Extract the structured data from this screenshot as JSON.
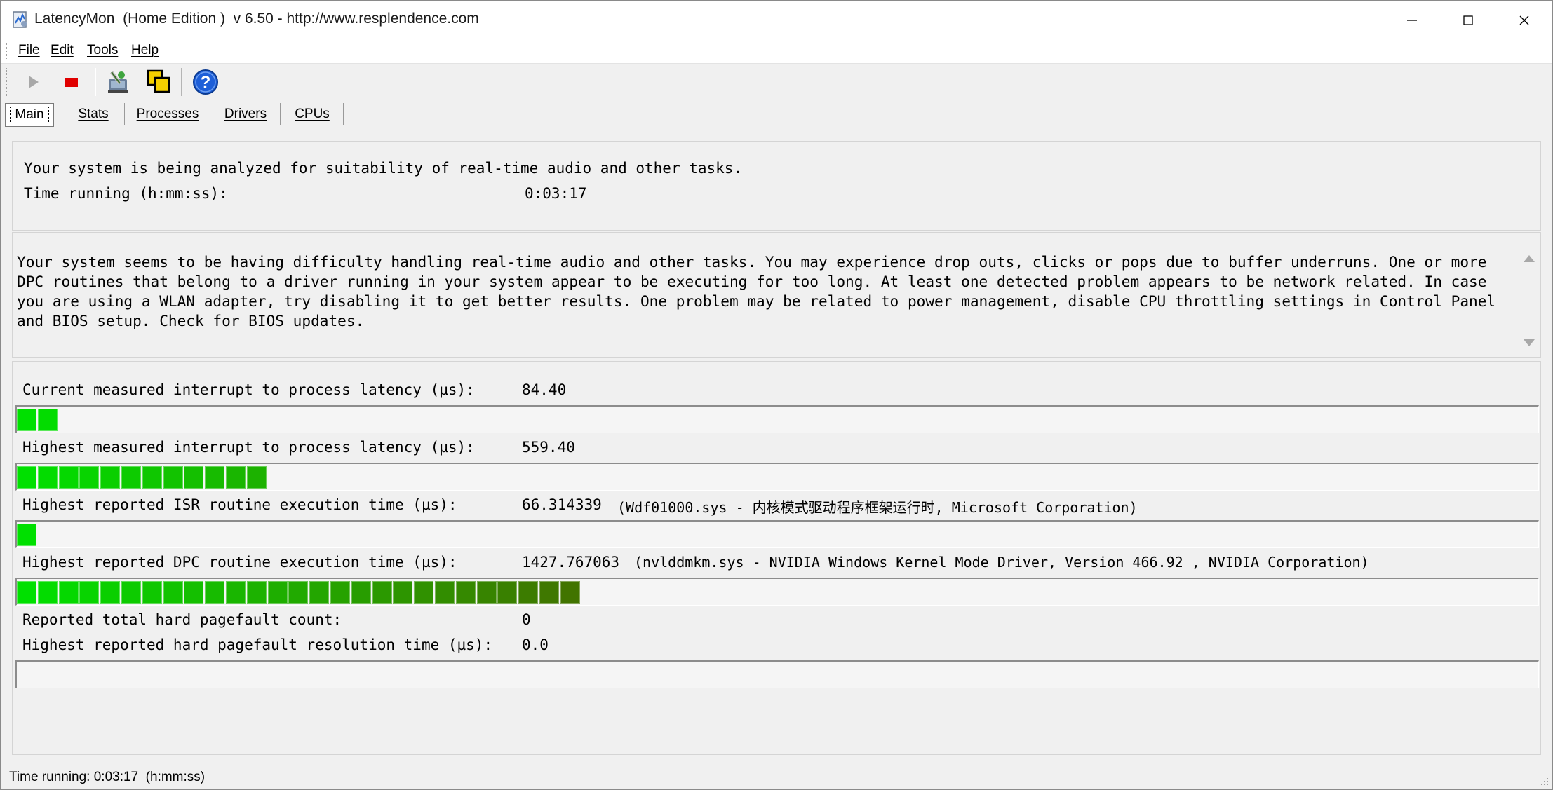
{
  "window": {
    "title": "LatencyMon  (Home Edition )  v 6.50 - http://www.resplendence.com"
  },
  "menu": {
    "items": [
      {
        "label": "File"
      },
      {
        "label": "Edit"
      },
      {
        "label": "Tools"
      },
      {
        "label": "Help"
      }
    ]
  },
  "toolbar": {
    "buttons": [
      "play-icon",
      "stop-icon",
      "network-tool-icon",
      "windows-icon",
      "help-icon"
    ]
  },
  "tabs": [
    {
      "label": "Main",
      "active": true
    },
    {
      "label": "Stats",
      "active": false
    },
    {
      "label": "Processes",
      "active": false
    },
    {
      "label": "Drivers",
      "active": false
    },
    {
      "label": "CPUs",
      "active": false
    }
  ],
  "status_panel": {
    "line1": "Your system is being analyzed for suitability of real-time audio and other tasks.",
    "time_label": "Time running (h:mm:ss):",
    "time_value": "0:03:17"
  },
  "message": {
    "text": "Your system seems to be having difficulty handling real-time audio and other tasks. You may experience drop outs, clicks or pops due to buffer underruns. One or more DPC routines that belong to a driver running in your system appear to be executing for too long. At least one detected problem appears to be network related. In case you are using a WLAN adapter, try disabling it to get better results. One problem may be related to power management, disable CPU throttling settings in Control Panel and BIOS setup. Check for BIOS updates."
  },
  "metrics": {
    "current_latency": {
      "label": "Current measured interrupt to process latency (µs):",
      "value": "84.40",
      "bar_segments": 2
    },
    "highest_latency": {
      "label": "Highest measured interrupt to process latency (µs):",
      "value": "559.40",
      "bar_segments": 12
    },
    "isr": {
      "label": "Highest reported ISR routine execution time (µs):",
      "value": "66.314339",
      "detail": "(Wdf01000.sys - 内核模式驱动程序框架运行时, Microsoft Corporation)",
      "bar_segments": 1
    },
    "dpc": {
      "label": "Highest reported DPC routine execution time (µs):",
      "value": "1427.767063",
      "detail": "(nvlddmkm.sys - NVIDIA Windows Kernel Mode Driver, Version 466.92 , NVIDIA Corporation)",
      "bar_segments": 27
    },
    "pagefault_count": {
      "label": "Reported total hard pagefault count:",
      "value": "0"
    },
    "pagefault_time": {
      "label": "Highest reported hard pagefault resolution time (µs):",
      "value": "0.0",
      "bar_segments": 0
    }
  },
  "colors": {
    "bar_start": "#00e000",
    "bar_end": "#5a4a00",
    "stop": "#e00000",
    "help": "#1e5fd8"
  },
  "statusbar": {
    "text": "Time running: 0:03:17  (h:mm:ss)"
  }
}
